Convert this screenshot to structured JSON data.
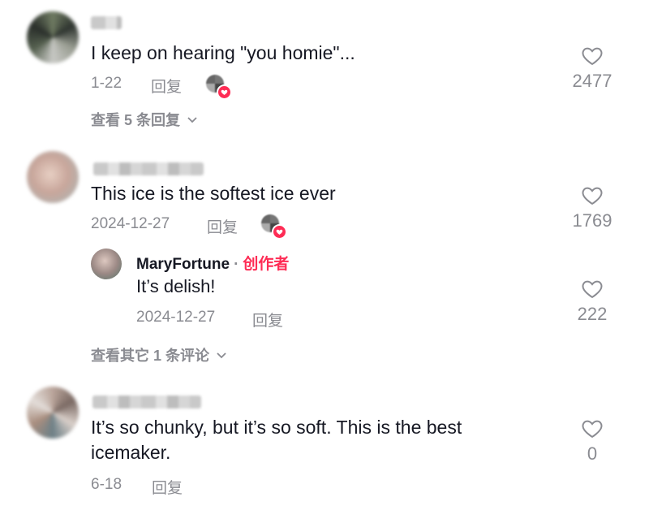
{
  "comments": [
    {
      "text": "I keep on hearing \"you homie\"...",
      "date": "1-22",
      "reply_label": "回复",
      "likes": "2477",
      "liked_by_creator": true,
      "view_replies": "查看 5 条回复"
    },
    {
      "text": "This ice is the softest ice ever",
      "date": "2024-12-27",
      "reply_label": "回复",
      "likes": "1769",
      "liked_by_creator": true,
      "reply": {
        "author": "MaryFortune",
        "separator": "·",
        "badge": "创作者",
        "text": "It’s delish!",
        "date": "2024-12-27",
        "reply_label": "回复",
        "likes": "222"
      },
      "view_replies": "查看其它 1 条评论"
    },
    {
      "text_line1": "It’s so chunky, but it’s so soft. This is the best",
      "text_line2": "icemaker.",
      "date": "6-18",
      "reply_label": "回复",
      "likes": "0"
    }
  ],
  "icons": {
    "like": "heart-outline-icon",
    "expand": "chevron-down-icon",
    "creator_liked": "creator-liked-icon"
  },
  "colors": {
    "accent": "#fe2c55",
    "text": "#161823",
    "muted": "#8a8b91"
  }
}
